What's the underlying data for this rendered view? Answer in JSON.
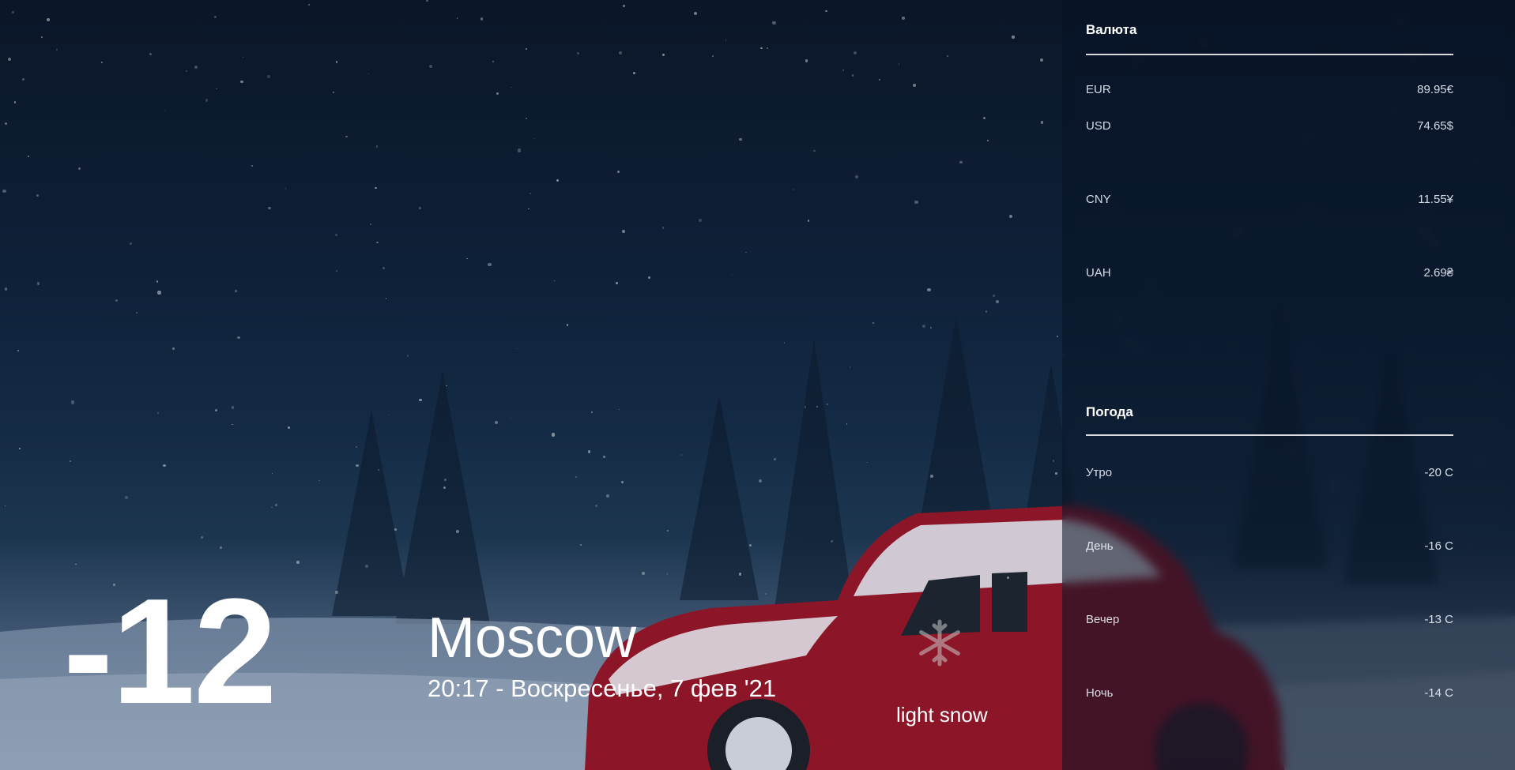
{
  "currency": {
    "title": "Валюта",
    "items": [
      {
        "code": "EUR",
        "value": "89.95€"
      },
      {
        "code": "USD",
        "value": "74.65$"
      },
      {
        "code": "CNY",
        "value": "11.55¥"
      },
      {
        "code": "UAH",
        "value": "2.69₴"
      }
    ]
  },
  "forecast": {
    "title": "Погода",
    "items": [
      {
        "period": "Утро",
        "value": "-20 C"
      },
      {
        "period": "День",
        "value": "-16 C"
      },
      {
        "period": "Вечер",
        "value": "-13 C"
      },
      {
        "period": "Ночь",
        "value": "-14 C"
      }
    ]
  },
  "current": {
    "temperature": "-12",
    "city": "Moscow",
    "datetime": "20:17 - Воскресенье, 7 фев '21",
    "condition": "light snow",
    "icon": "snowflake-icon"
  }
}
